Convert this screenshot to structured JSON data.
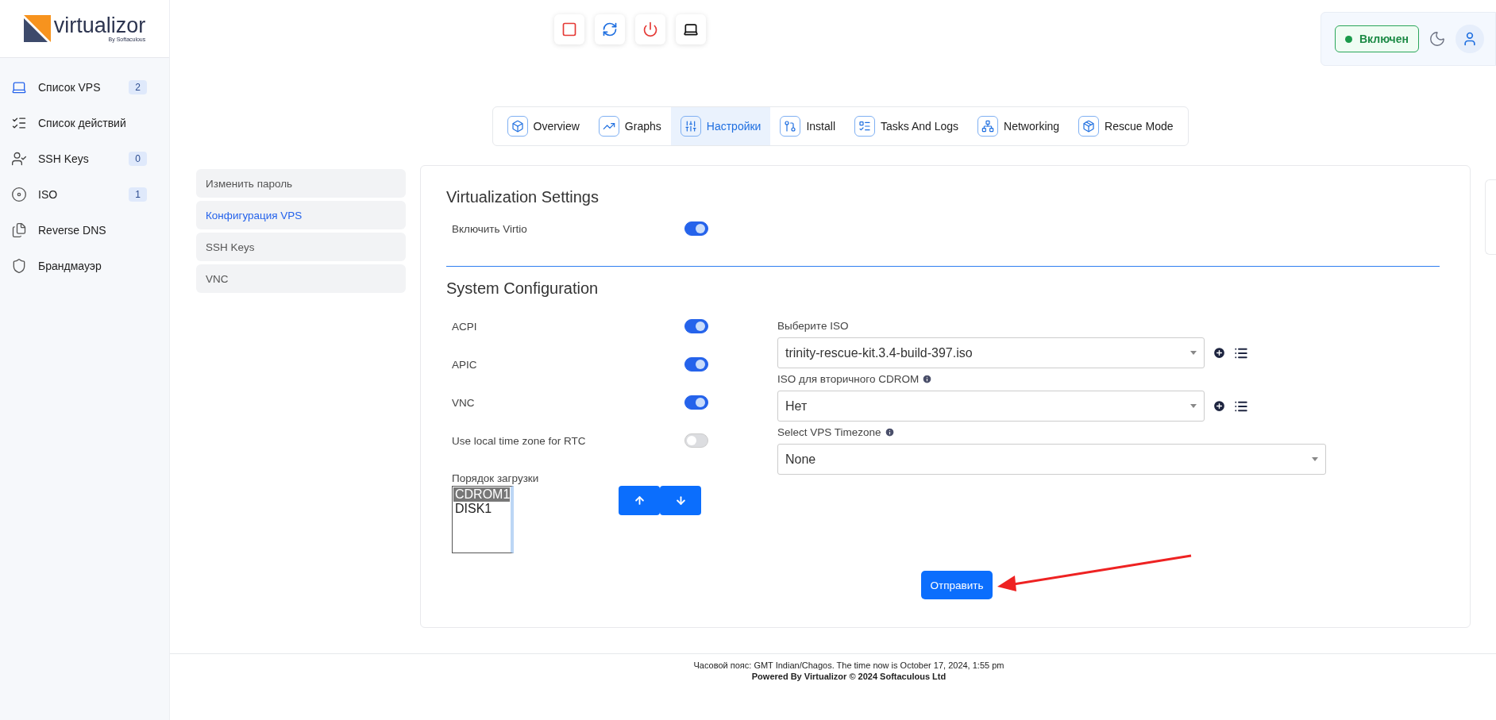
{
  "logo": {
    "name": "virtualizor",
    "tagline": "By Softaculous"
  },
  "sidebar": {
    "items": [
      {
        "label": "Список VPS",
        "count": "2",
        "kind": "laptop"
      },
      {
        "label": "Список действий",
        "kind": "checklist"
      },
      {
        "label": "SSH Keys",
        "count": "0",
        "kind": "user"
      },
      {
        "label": "ISO",
        "count": "1",
        "kind": "disc"
      },
      {
        "label": "Reverse DNS",
        "kind": "files"
      },
      {
        "label": "Брандмауэр",
        "kind": "firewall"
      }
    ]
  },
  "status": {
    "label": "Включен",
    "on": true
  },
  "tabs": [
    {
      "label": "Overview",
      "selected": false,
      "kind": "cube"
    },
    {
      "label": "Graphs",
      "selected": false,
      "kind": "graph"
    },
    {
      "label": "Настройки",
      "selected": true,
      "kind": "sliders"
    },
    {
      "label": "Install",
      "selected": false,
      "kind": "install"
    },
    {
      "label": "Tasks And Logs",
      "selected": false,
      "kind": "tasks"
    },
    {
      "label": "Networking",
      "selected": false,
      "kind": "network"
    },
    {
      "label": "Rescue Mode",
      "selected": false,
      "kind": "rescue"
    }
  ],
  "submenu": [
    {
      "label": "Изменить пароль",
      "selected": false
    },
    {
      "label": "Конфигурация VPS",
      "selected": true
    },
    {
      "label": "SSH Keys",
      "selected": false
    },
    {
      "label": "VNC",
      "selected": false
    }
  ],
  "virtualization": {
    "title": "Virtualization Settings",
    "toggles": [
      {
        "label": "Включить Virtio",
        "on": true
      }
    ]
  },
  "system": {
    "title": "System Configuration",
    "toggles": [
      {
        "label": "ACPI",
        "on": true
      },
      {
        "label": "APIC",
        "on": true
      },
      {
        "label": "VNC",
        "on": true
      },
      {
        "label": "Use local time zone for RTC",
        "on": false
      }
    ],
    "boot_order": {
      "label": "Порядок загрузки",
      "items": [
        {
          "label": "CDROM1",
          "selected": true
        },
        {
          "label": "DISK1",
          "selected": false
        }
      ]
    },
    "selects": [
      {
        "label": "Выберите ISO",
        "value": "trinity-rescue-kit.3.4-build-397.iso",
        "info": false,
        "actions": true
      },
      {
        "label": "ISO для вторичного CDROM",
        "value": "Нет",
        "info": true,
        "actions": true
      },
      {
        "label": "Select VPS Timezone",
        "value": "None",
        "info": true,
        "actions": false
      }
    ]
  },
  "submit": "Отправить",
  "footer": {
    "time": "Часовой пояс: GMT Indian/Chagos. The time now is October 17, 2024, 1:55 pm",
    "powered": "Powered By Virtualizor © 2024 Softaculous Ltd"
  }
}
